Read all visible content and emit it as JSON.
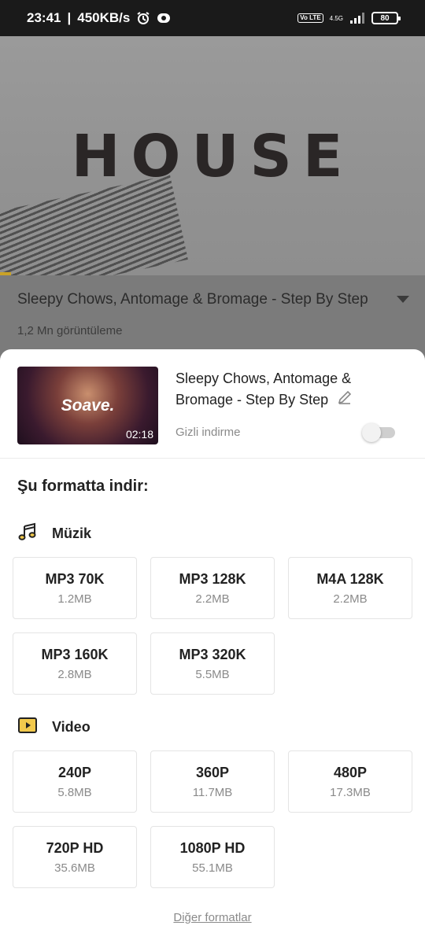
{
  "status_bar": {
    "time": "23:41",
    "speed": "450KB/s",
    "network": "4.5G",
    "volte": "Vo LTE",
    "battery": "80"
  },
  "video": {
    "thumbnail_text": "HOUSE",
    "title": "Sleepy Chows, Antomage & Bromage - Step By Step",
    "views": "1,2 Mn görüntüleme"
  },
  "sheet": {
    "media_logo": "Soave.",
    "duration": "02:18",
    "title": "Sleepy Chows, Antomage & Bromage - Step By Step",
    "private_label": "Gizli indirme",
    "private_enabled": false,
    "heading": "Şu formatta indir:",
    "music": {
      "label": "Müzik",
      "formats": [
        {
          "name": "MP3 70K",
          "size": "1.2MB"
        },
        {
          "name": "MP3 128K",
          "size": "2.2MB"
        },
        {
          "name": "M4A 128K",
          "size": "2.2MB"
        },
        {
          "name": "MP3 160K",
          "size": "2.8MB"
        },
        {
          "name": "MP3 320K",
          "size": "5.5MB"
        }
      ]
    },
    "video": {
      "label": "Video",
      "formats": [
        {
          "name": "240P",
          "size": "5.8MB"
        },
        {
          "name": "360P",
          "size": "11.7MB"
        },
        {
          "name": "480P",
          "size": "17.3MB"
        },
        {
          "name": "720P HD",
          "size": "35.6MB"
        },
        {
          "name": "1080P HD",
          "size": "55.1MB"
        }
      ]
    },
    "more_formats": "Diğer formatlar"
  },
  "colors": {
    "accent": "#c9a227",
    "icon_yellow": "#f2c94c"
  }
}
